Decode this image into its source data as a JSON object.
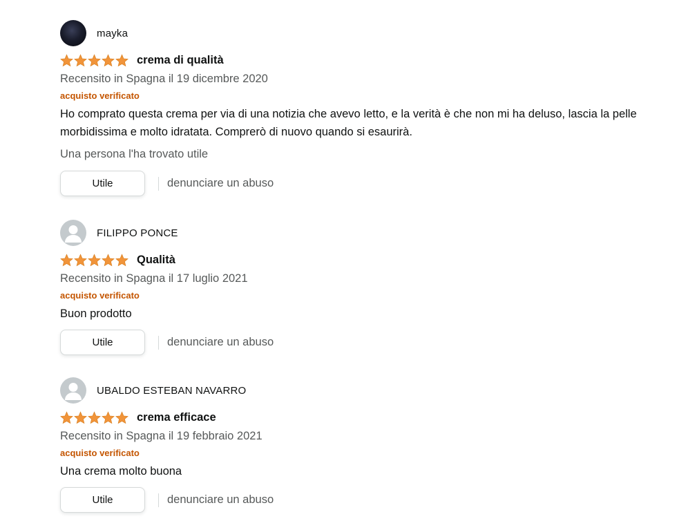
{
  "reviews": [
    {
      "profile_name": "mayka",
      "rating": 5,
      "title": "crema di qualità",
      "date": "Recensito in Spagna il 19 dicembre 2020",
      "verified": "acquisto verificato",
      "body": "Ho comprato questa crema per via di una notizia che avevo letto, e la verità è che non mi ha deluso, lascia la pelle morbidissima e molto idratata. Comprerò di nuovo quando si esaurirà.",
      "helpful": "Una persona l'ha trovato utile",
      "helpful_button": "Utile",
      "report": "denunciare un abuso"
    },
    {
      "profile_name": "FILIPPO PONCE",
      "rating": 5,
      "title": "Qualità",
      "date": "Recensito in Spagna il 17 luglio 2021",
      "verified": "acquisto verificato",
      "body": "Buon prodotto",
      "helpful_button": "Utile",
      "report": "denunciare un abuso"
    },
    {
      "profile_name": "UBALDO ESTEBAN NAVARRO",
      "rating": 5,
      "title": "crema efficace",
      "date": "Recensito in Spagna il 19 febbraio 2021",
      "verified": "acquisto verificato",
      "body": "Una crema molto buona",
      "helpful_button": "Utile",
      "report": "denunciare un abuso"
    }
  ],
  "colors": {
    "star": "#f1943a",
    "verified": "#c45500",
    "secondary_text": "#565959"
  }
}
